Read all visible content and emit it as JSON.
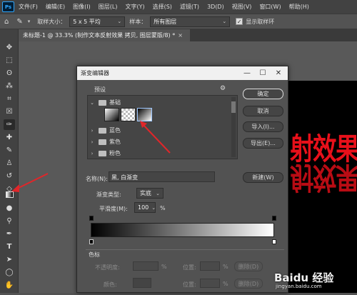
{
  "app": {
    "logo": "Ps"
  },
  "menubar": {
    "items": [
      "文件(F)",
      "编辑(E)",
      "图像(I)",
      "图层(L)",
      "文字(Y)",
      "选择(S)",
      "滤镜(T)",
      "3D(D)",
      "视图(V)",
      "窗口(W)",
      "帮助(H)"
    ]
  },
  "options": {
    "home_icon": "home-icon",
    "sample_size_label": "取样大小：",
    "sample_size_value": "5 x 5 平均",
    "sample_label": "样本：",
    "sample_value": "所有图层",
    "show_ring_label": "显示取样环",
    "show_ring_checked": true
  },
  "document": {
    "tab_title": "未标题-1 @ 33.3% (制作文本反射效果 拷贝, 图层蒙版/8) *",
    "close": "×"
  },
  "canvas": {
    "text": "射效果",
    "reflection": "射效果",
    "text_color": "#e8101a"
  },
  "dialog": {
    "title": "渐变编辑器",
    "presets_label": "预设",
    "folders": [
      {
        "name": "基础",
        "expanded": true
      },
      {
        "name": "蓝色",
        "expanded": false
      },
      {
        "name": "紫色",
        "expanded": false
      },
      {
        "name": "粉色",
        "expanded": false
      }
    ],
    "buttons": {
      "ok": "确定",
      "cancel": "取消",
      "import": "导入(I)...",
      "export": "导出(E)...",
      "new": "新建(W)"
    },
    "name_label": "名称(N):",
    "name_value": "黑, 白渐变",
    "gradient_type_label": "渐变类型:",
    "gradient_type_value": "实底",
    "smoothness_label": "平滑度(M):",
    "smoothness_value": "100",
    "smoothness_unit": "%",
    "stops_label": "色标",
    "opacity_label": "不透明度:",
    "location_label": "位置:",
    "color_label": "颜色:",
    "percent": "%",
    "delete_label": "删除(D)"
  },
  "watermark": {
    "text": "Baidu 经验",
    "sub": "jingyan.baidu.com"
  },
  "colors": {
    "annotation_red": "#e0262a",
    "ps_blue": "#31a8ff"
  }
}
